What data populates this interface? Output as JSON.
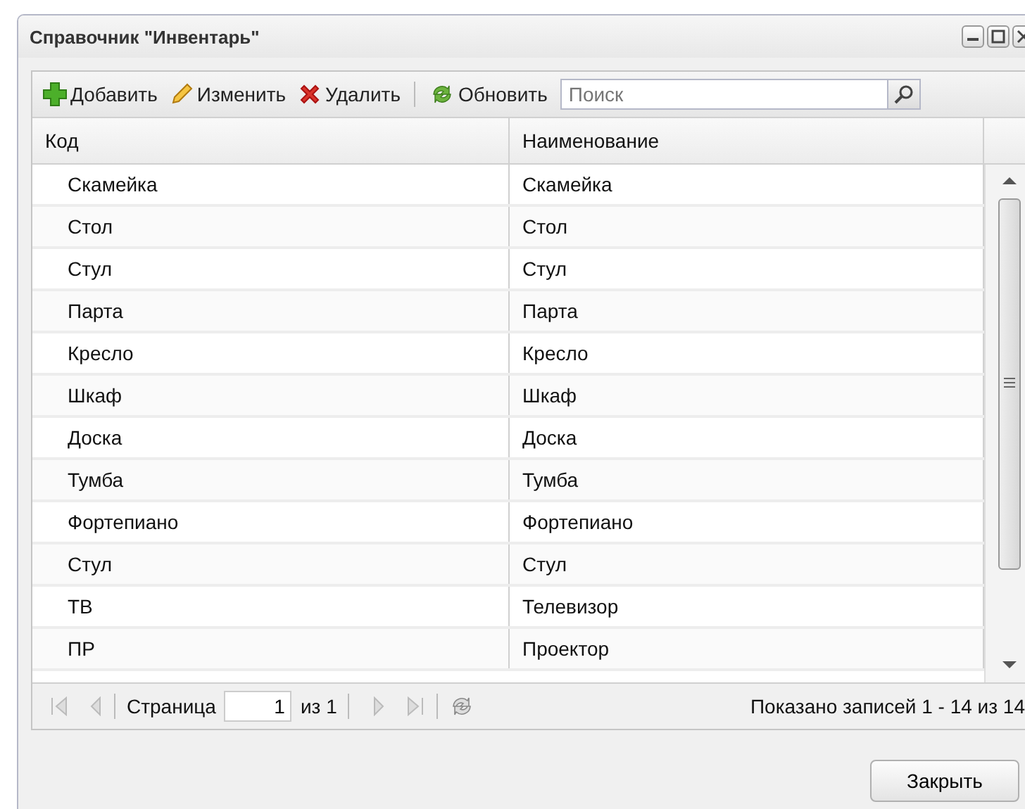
{
  "window": {
    "title": "Справочник \"Инвентарь\""
  },
  "toolbar": {
    "buttons": [
      {
        "kind": "add",
        "label": "Добавить"
      },
      {
        "kind": "edit",
        "label": "Изменить"
      },
      {
        "kind": "delete",
        "label": "Удалить"
      },
      {
        "kind": "refresh",
        "label": "Обновить"
      }
    ],
    "search": {
      "placeholder": "Поиск"
    }
  },
  "table": {
    "columns": [
      "Код",
      "Наименование"
    ],
    "rows": [
      [
        "Скамейка",
        "Скамейка"
      ],
      [
        "Стол",
        "Стол"
      ],
      [
        "Стул",
        "Стул"
      ],
      [
        "Парта",
        "Парта"
      ],
      [
        "Кресло",
        "Кресло"
      ],
      [
        "Шкаф",
        "Шкаф"
      ],
      [
        "Доска",
        "Доска"
      ],
      [
        "Тумба",
        "Тумба"
      ],
      [
        "Фортепиано",
        "Фортепиано"
      ],
      [
        "Стул",
        "Стул"
      ],
      [
        "ТВ",
        "Телевизор"
      ],
      [
        "ПР",
        "Проектор"
      ]
    ]
  },
  "pager": {
    "page_label": "Страница",
    "page": "1",
    "of": "из 1",
    "summary": "Показано записей 1 - 14 из 14"
  },
  "footer": {
    "close": "Закрыть"
  }
}
